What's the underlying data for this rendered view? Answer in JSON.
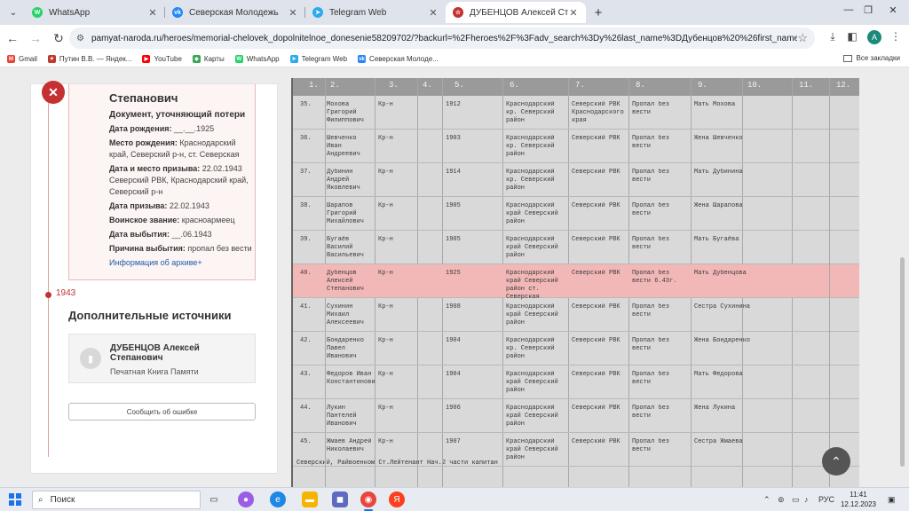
{
  "browser": {
    "tabs": [
      {
        "title": "WhatsApp",
        "icon": "whatsapp-icon",
        "color": "#25D366",
        "glyph": "W"
      },
      {
        "title": "Северская Молодежь",
        "icon": "vk-icon",
        "color": "#2787F5",
        "glyph": "vk"
      },
      {
        "title": "Telegram Web",
        "icon": "telegram-icon",
        "color": "#2AABEE",
        "glyph": "➤"
      },
      {
        "title": "ДУБЕНЦОВ Алексей Степанович",
        "icon": "memory-star-icon",
        "color": "#c53030",
        "glyph": "☆"
      }
    ],
    "url": "pamyat-naroda.ru/heroes/memorial-chelovek_dopolnitelnoe_donesenie58209702/?backurl=%2Fheroes%2F%3Fadv_search%3Dy%26last_name%3DДубенцов%20%26first_name%3DАле...",
    "avatar_letter": "A",
    "bookmarks": [
      {
        "label": "Gmail",
        "color": "#EA4335",
        "glyph": "M"
      },
      {
        "label": "Путин В.В. — Яндек...",
        "color": "#c0392b",
        "glyph": "✦"
      },
      {
        "label": "YouTube",
        "color": "#FF0000",
        "glyph": "▶"
      },
      {
        "label": "Карты",
        "color": "#34A853",
        "glyph": "◆"
      },
      {
        "label": "WhatsApp",
        "color": "#25D366",
        "glyph": "W"
      },
      {
        "label": "Telegram Web",
        "color": "#2AABEE",
        "glyph": "➤"
      },
      {
        "label": "Северская Молоде...",
        "color": "#2787F5",
        "glyph": "vk"
      }
    ],
    "all_bookmarks": "Все закладки"
  },
  "record": {
    "name": "Степанович",
    "doc_type": "Документ, уточняющий потери",
    "fields": [
      {
        "label": "Дата рождения:",
        "value": "__.__.1925"
      },
      {
        "label": "Место рождения:",
        "value": "Краснодарский край, Северский р-н, ст. Северская"
      },
      {
        "label": "Дата и место призыва:",
        "value": "22.02.1943 Северский РВК, Краснодарский край, Северский р-н"
      },
      {
        "label": "Дата призыва:",
        "value": "22.02.1943"
      },
      {
        "label": "Воинское звание:",
        "value": "красноармеец"
      },
      {
        "label": "Дата выбытия:",
        "value": "__.06.1943"
      },
      {
        "label": "Причина выбытия:",
        "value": "пропал без вести"
      }
    ],
    "more_link": "Информация об архиве+"
  },
  "timeline": {
    "year": "1943"
  },
  "sources": {
    "title": "Дополнительные источники",
    "items": [
      {
        "name": "ДУБЕНЦОВ Алексей Степанович",
        "sub": "Печатная Книга Памяти"
      }
    ]
  },
  "report_button": "Сообщить об ошибке",
  "document_scan": {
    "column_numbers": [
      "1.",
      "2.",
      "3.",
      "4.",
      "5.",
      "6.",
      "7.",
      "8.",
      "9.",
      "10.",
      "11.",
      "12."
    ],
    "rows": [
      {
        "no": "35.",
        "name": "Мохова Григорий Филиппович",
        "rank": "Кр-н",
        "year": "1912",
        "place": "Краснодарский кр. Северский район",
        "rvk": "Северский РВК Краснодарского края",
        "status": "Пропал без вести",
        "kin": "Мать Мохова",
        "highlight": false
      },
      {
        "no": "36.",
        "name": "Шевченко Иван Андреевич",
        "rank": "Кр-н",
        "year": "1903",
        "place": "Краснодарский кр. Северский район",
        "rvk": "Северский РВК",
        "status": "Пропал без вести",
        "kin": "Жена Шевченко",
        "highlight": false
      },
      {
        "no": "37.",
        "name": "Дубинин Андрей Яковлевич",
        "rank": "Кр-н",
        "year": "1914",
        "place": "Краснодарский кр. Северский район",
        "rvk": "Северский РВК",
        "status": "Пропал без вести",
        "kin": "Мать Дубинина",
        "highlight": false
      },
      {
        "no": "38.",
        "name": "Шарапов Григорий Михайлович",
        "rank": "Кр-н",
        "year": "1905",
        "place": "Краснодарский край Северский район",
        "rvk": "Северский РВК",
        "status": "Пропал без вести",
        "kin": "Жена Шарапова",
        "highlight": false
      },
      {
        "no": "39.",
        "name": "Бугаёв Василий Васильевич",
        "rank": "Кр-н",
        "year": "1905",
        "place": "Краснодарский край Северский район",
        "rvk": "Северский РВК",
        "status": "Пропал без вести",
        "kin": "Мать Бугаёва",
        "highlight": false
      },
      {
        "no": "40.",
        "name": "Дубенцов Алексей Степанович",
        "rank": "Кр-н",
        "year": "1925",
        "place": "Краснодарский край Северский район ст. Северская",
        "rvk": "Северский РВК",
        "status": "Пропал без вести 6.43г.",
        "kin": "Мать Дубенцова",
        "highlight": true
      },
      {
        "no": "41.",
        "name": "Сухинин Михаил Алексеевич",
        "rank": "Кр-н",
        "year": "1908",
        "place": "Краснодарский край Северский район",
        "rvk": "Северский РВК",
        "status": "Пропал без вести",
        "kin": "Сестра Сухинина",
        "highlight": false
      },
      {
        "no": "42.",
        "name": "Бондаренко Павел Иванович",
        "rank": "Кр-н",
        "year": "1904",
        "place": "Краснодарский кр. Северский район",
        "rvk": "Северский РВК",
        "status": "Пропал без вести",
        "kin": "Жена Бондаренко",
        "highlight": false
      },
      {
        "no": "43.",
        "name": "Федоров Иван Константинович",
        "rank": "Кр-н",
        "year": "1904",
        "place": "Краснодарский край Северский район",
        "rvk": "Северский РВК",
        "status": "Пропал без вести",
        "kin": "Мать Федорова",
        "highlight": false
      },
      {
        "no": "44.",
        "name": "Лукин Пантелей Иванович",
        "rank": "Кр-н",
        "year": "1906",
        "place": "Краснодарский край Северский район",
        "rvk": "Северский РВК",
        "status": "Пропал без вести",
        "kin": "Жена Лукина",
        "highlight": false
      },
      {
        "no": "45.",
        "name": "Жмаев Андрей Николаевич",
        "rank": "Кр-н",
        "year": "1907",
        "place": "Краснодарский край Северский район",
        "rvk": "Северский РВК",
        "status": "Пропал без вести",
        "kin": "Сестра Жмаева",
        "highlight": false
      }
    ],
    "footer": "Северский, Райвоенком Ст.Лейтенант  Нач.2 части капитан"
  },
  "taskbar": {
    "search_placeholder": "Поиск",
    "lang": "РУС",
    "time": "11:41",
    "date": "12.12.2023"
  }
}
